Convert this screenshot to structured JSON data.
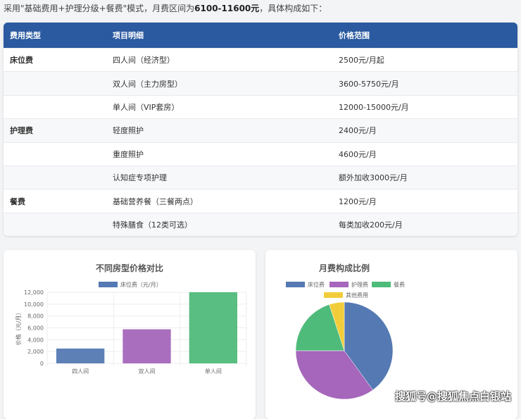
{
  "intro": {
    "before": "采用\"基础费用+护理分级+餐费\"模式，月费区间为",
    "range": "6100-11600元",
    "after": "，具体构成如下："
  },
  "table": {
    "headers": [
      "费用类型",
      "项目明细",
      "价格范围"
    ],
    "rows": [
      [
        "床位费",
        "四人间（经济型）",
        "2500元/月起"
      ],
      [
        "",
        "双人间（主力房型）",
        "3600-5750元/月"
      ],
      [
        "",
        "单人间（VIP套房）",
        "12000-15000元/月"
      ],
      [
        "护理费",
        "轻度照护",
        "2400元/月"
      ],
      [
        "",
        "重度照护",
        "4600元/月"
      ],
      [
        "",
        "认知症专项护理",
        "额外加收3000元/月"
      ],
      [
        "餐费",
        "基础营养餐（三餐两点）",
        "1200元/月"
      ],
      [
        "",
        "特殊膳食（12类可选）",
        "每类加收200元/月"
      ]
    ]
  },
  "chart_data": [
    {
      "type": "bar",
      "title": "不同房型价格对比",
      "legend": [
        "床位费（元/月）"
      ],
      "categories": [
        "四人间",
        "双人间",
        "单人间"
      ],
      "values": [
        2500,
        5750,
        12000
      ],
      "colors": [
        "#5479b3",
        "#a566bb",
        "#4fbb7a"
      ],
      "ylabel": "价格（元/月）",
      "ylim": [
        0,
        12000
      ],
      "yticks": [
        "0",
        "2,000",
        "4,000",
        "6,000",
        "8,000",
        "10,000",
        "12,000"
      ],
      "grid": true
    },
    {
      "type": "pie",
      "title": "月费构成比例",
      "labels": [
        "床位费",
        "护理费",
        "餐费",
        "其他费用"
      ],
      "values": [
        40,
        35,
        20,
        5
      ],
      "colors": [
        "#5479b3",
        "#a566bb",
        "#4fbb7a",
        "#f2cd3b"
      ],
      "legend": "top"
    }
  ],
  "watermark": "搜狐号@搜狐焦点白银站"
}
